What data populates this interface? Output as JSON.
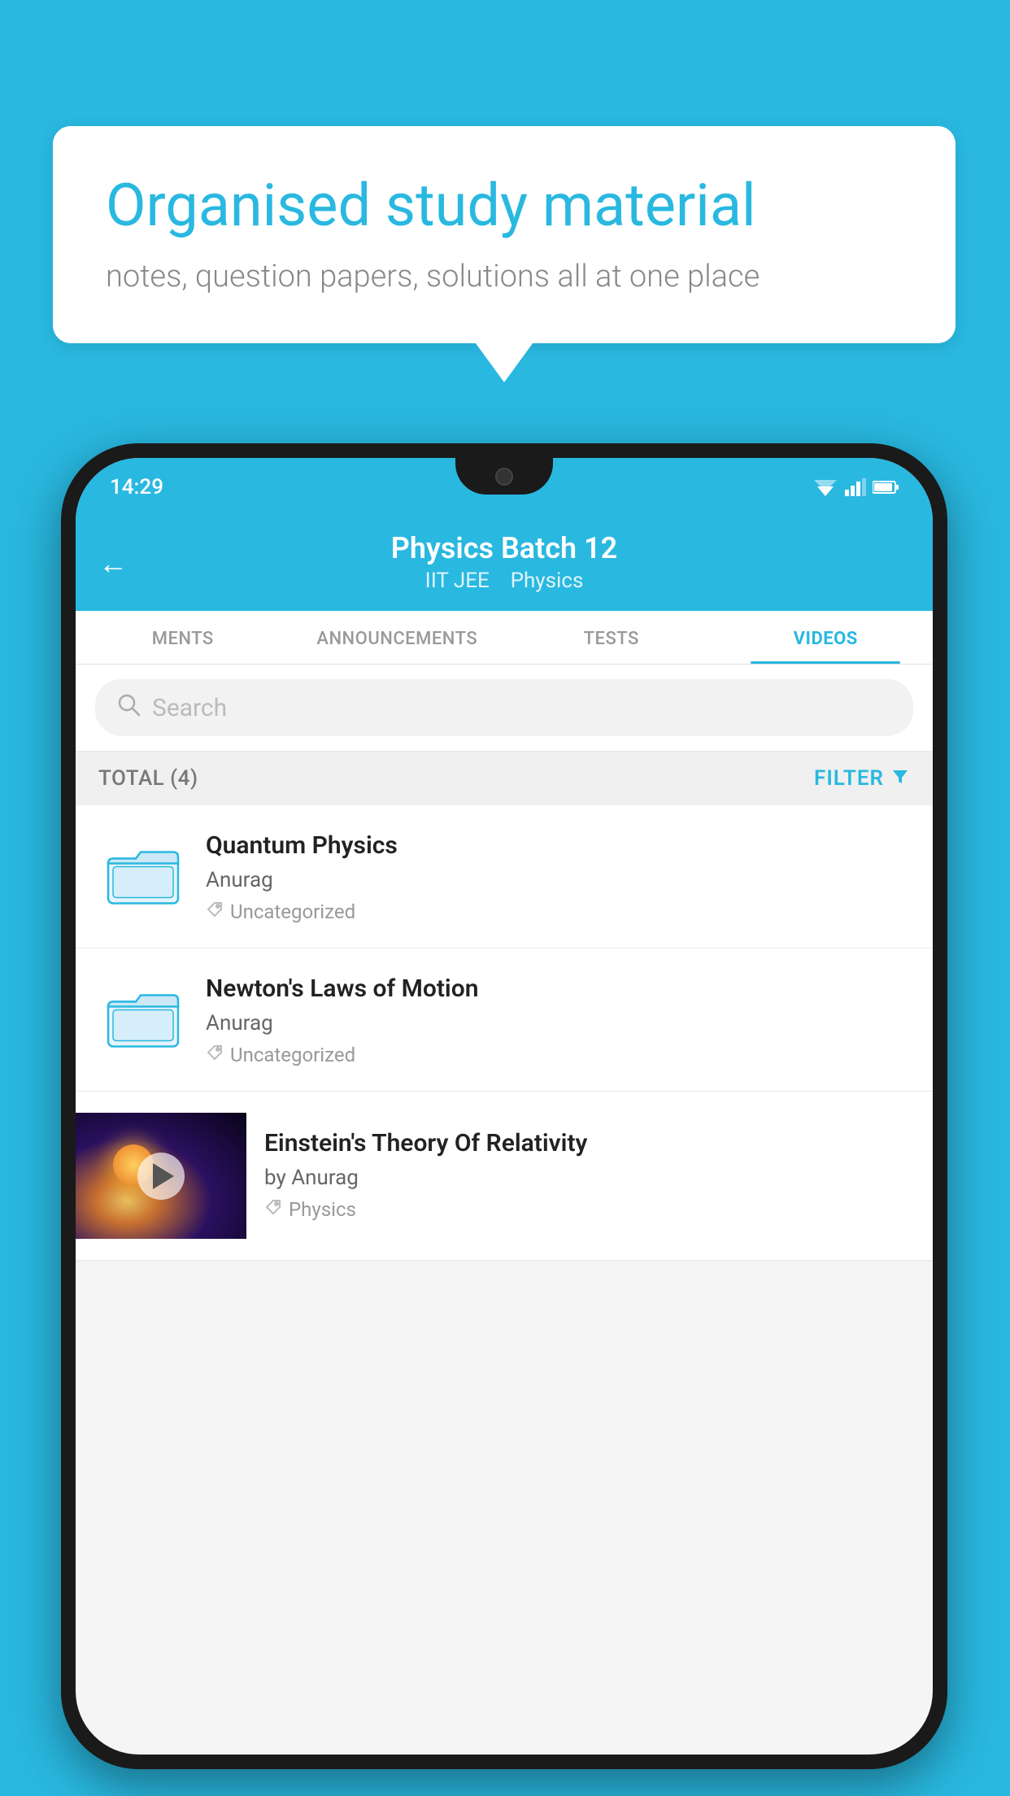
{
  "background_color": "#29b8e0",
  "speech_bubble": {
    "heading": "Organised study material",
    "subtext": "notes, question papers, solutions all at one place"
  },
  "phone": {
    "status_bar": {
      "time": "14:29"
    },
    "app_header": {
      "title": "Physics Batch 12",
      "subtitle_tag1": "IIT JEE",
      "subtitle_tag2": "Physics",
      "back_label": "←"
    },
    "tabs": [
      {
        "label": "MENTS",
        "active": false
      },
      {
        "label": "ANNOUNCEMENTS",
        "active": false
      },
      {
        "label": "TESTS",
        "active": false
      },
      {
        "label": "VIDEOS",
        "active": true
      }
    ],
    "search": {
      "placeholder": "Search"
    },
    "filter_row": {
      "total_label": "TOTAL (4)",
      "filter_label": "FILTER"
    },
    "videos": [
      {
        "id": "quantum",
        "title": "Quantum Physics",
        "author": "Anurag",
        "tag": "Uncategorized",
        "type": "folder"
      },
      {
        "id": "newton",
        "title": "Newton's Laws of Motion",
        "author": "Anurag",
        "tag": "Uncategorized",
        "type": "folder"
      },
      {
        "id": "einstein",
        "title": "Einstein's Theory Of Relativity",
        "author": "by Anurag",
        "tag": "Physics",
        "type": "video"
      }
    ]
  }
}
